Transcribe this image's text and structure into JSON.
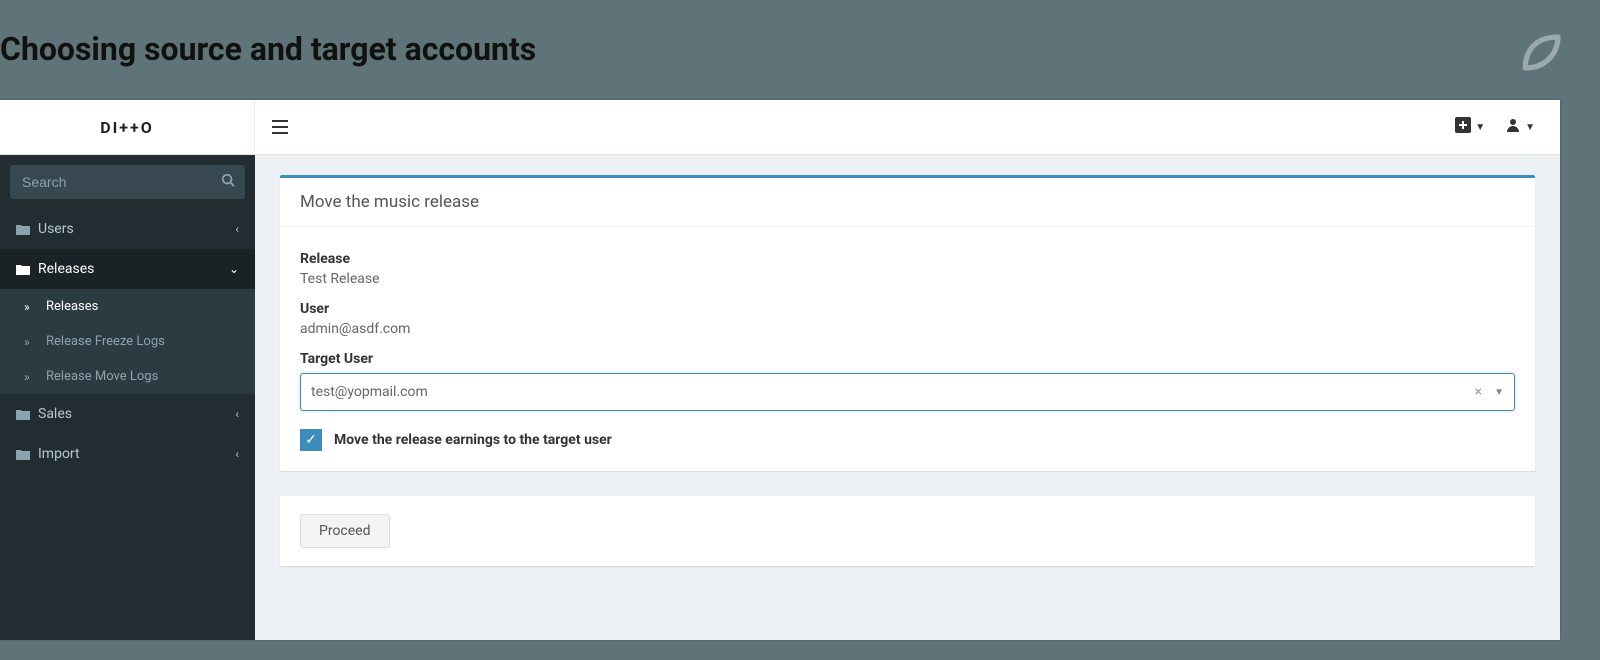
{
  "banner": {
    "title": "Choosing source and target accounts"
  },
  "topbar": {
    "logo_text": "DI++O"
  },
  "sidebar": {
    "search_placeholder": "Search",
    "items": [
      {
        "label": "Users",
        "expanded": false
      },
      {
        "label": "Releases",
        "expanded": true,
        "children": [
          {
            "label": "Releases",
            "active": true
          },
          {
            "label": "Release Freeze Logs",
            "active": false
          },
          {
            "label": "Release Move Logs",
            "active": false
          }
        ]
      },
      {
        "label": "Sales",
        "expanded": false
      },
      {
        "label": "Import",
        "expanded": false
      }
    ]
  },
  "panel": {
    "title": "Move the music release",
    "release_label": "Release",
    "release_value": "Test Release",
    "user_label": "User",
    "user_value": "admin@asdf.com",
    "target_user_label": "Target User",
    "target_user_value": "test@yopmail.com",
    "checkbox_label": "Move the release earnings to the target user",
    "checkbox_checked": true,
    "proceed_label": "Proceed"
  }
}
